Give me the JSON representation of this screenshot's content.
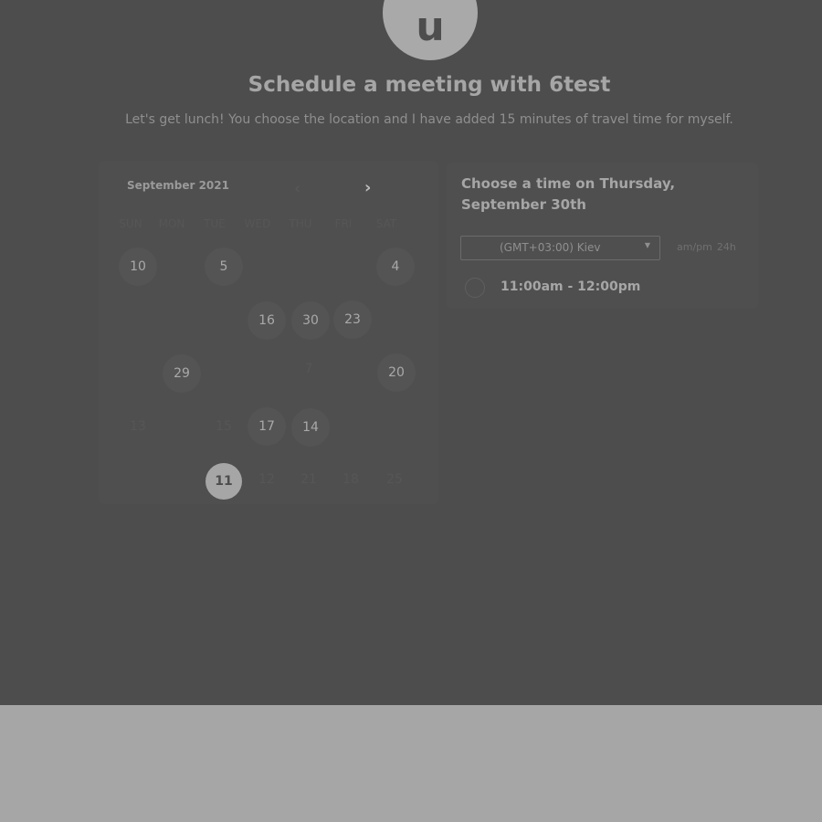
{
  "host": {
    "avatar_initial": "u",
    "heading": "Schedule a meeting with 6test",
    "description": "Let's get lunch! You choose the location and I have added 15 minutes of travel time for myself."
  },
  "calendar": {
    "month_label": "September 2021",
    "prev_icon": "chevron-left-icon",
    "next_icon": "chevron-right-icon",
    "weekdays": [
      "SUN",
      "MON",
      "TUE",
      "WED",
      "THU",
      "FRI",
      "SAT"
    ],
    "highlighted_days": [
      "10",
      "5",
      "4",
      "16",
      "30",
      "23",
      "29",
      "20",
      "17",
      "14"
    ],
    "faint_days": [
      "7",
      "13",
      "15",
      "12",
      "21",
      "18",
      "25"
    ],
    "selected_day": "11"
  },
  "time_panel": {
    "heading": "Choose a time on Thursday, September 30th",
    "timezone_value": "(GMT+03:00) Kiev",
    "format_options": [
      "am/pm",
      "24h"
    ],
    "slots": [
      "11:00am - 12:00pm"
    ]
  },
  "colors": {
    "overlay": "#4d4d4d",
    "footer": "#a6a6a6",
    "selected_day_bg": "#a6a6a6"
  }
}
